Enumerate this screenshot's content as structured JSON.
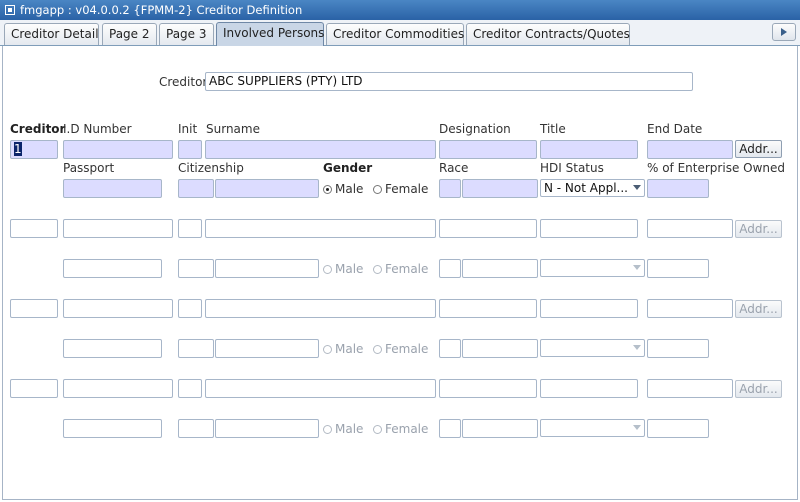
{
  "window": {
    "title": "fmgapp : v04.0.0.2  {FPMM-2} Creditor Definition"
  },
  "tabs": [
    {
      "label": "Creditor Detail"
    },
    {
      "label": "Page 2"
    },
    {
      "label": "Page 3"
    },
    {
      "label": "Involved Persons"
    },
    {
      "label": "Creditor Commodities"
    },
    {
      "label": "Creditor Contracts/Quotes"
    }
  ],
  "creditor": {
    "label": "Creditor",
    "value": "ABC SUPPLIERS (PTY) LTD"
  },
  "headers": {
    "creditor": "Creditor",
    "id_number": "I.D Number",
    "init": "Init",
    "surname": "Surname",
    "designation": "Designation",
    "title": "Title",
    "end_date": "End Date",
    "passport": "Passport",
    "citizenship": "Citizenship",
    "gender": "Gender",
    "race": "Race",
    "hdi_status": "HDI Status",
    "pct_owned": "% of Enterprise Owned"
  },
  "rows": [
    {
      "creditor": "1",
      "hdi_status": "N - Not Appl...",
      "addr_label": "Addr...",
      "male_label": "Male",
      "female_label": "Female",
      "gender_selected": "male"
    },
    {
      "creditor": "",
      "hdi_status": "",
      "addr_label": "Addr...",
      "male_label": "Male",
      "female_label": "Female",
      "gender_selected": ""
    },
    {
      "creditor": "",
      "hdi_status": "",
      "addr_label": "Addr...",
      "male_label": "Male",
      "female_label": "Female",
      "gender_selected": ""
    },
    {
      "creditor": "",
      "hdi_status": "",
      "addr_label": "Addr...",
      "male_label": "Male",
      "female_label": "Female",
      "gender_selected": ""
    }
  ]
}
